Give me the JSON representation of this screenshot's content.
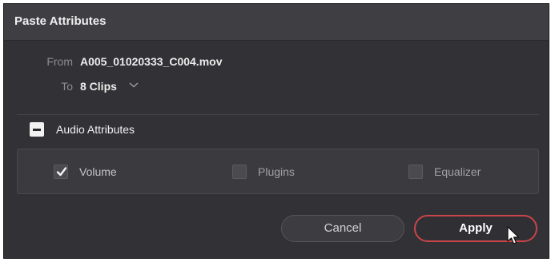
{
  "dialog": {
    "title": "Paste Attributes",
    "from_label": "From",
    "from_value": "A005_01020333_C004.mov",
    "to_label": "To",
    "to_value": "8 Clips",
    "section_label": "Audio Attributes",
    "attributes": [
      {
        "label": "Volume",
        "checked": true
      },
      {
        "label": "Plugins",
        "checked": false
      },
      {
        "label": "Equalizer",
        "checked": false
      }
    ],
    "cancel_label": "Cancel",
    "apply_label": "Apply"
  },
  "colors": {
    "background": "#323236",
    "titlebar": "#3e3e43",
    "apply_border": "#c8454a"
  },
  "icons": [
    "chevron-down-icon",
    "collapse-minus-icon",
    "checkmark-icon",
    "mouse-cursor-icon"
  ]
}
